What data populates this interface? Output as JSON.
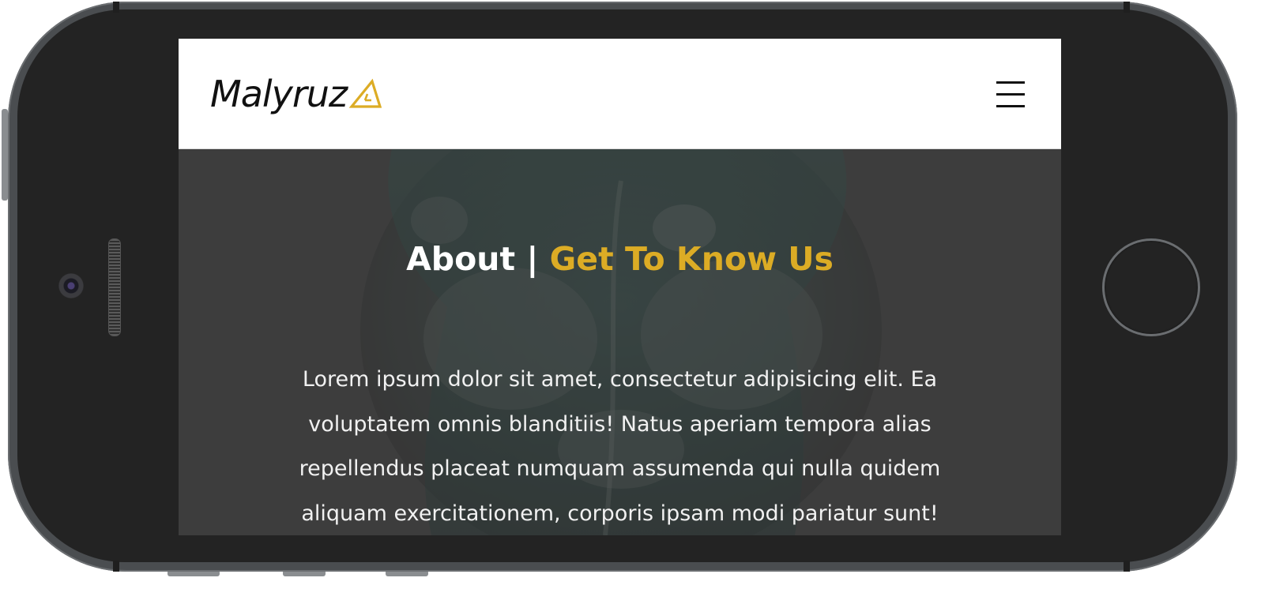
{
  "brand": {
    "name": "Malyruz",
    "accent_color": "#dcac25"
  },
  "nav": {
    "menu_icon": "hamburger-icon"
  },
  "hero": {
    "title_lead": "About |",
    "title_accent": "Get To Know Us",
    "body": "Lorem ipsum dolor sit amet, consectetur adipisicing elit. Ea voluptatem omnis blanditiis! Natus aperiam tempora alias repellendus placeat numquam assumenda qui nulla quidem aliquam exercitationem, corporis ipsam modi pariatur sunt!"
  },
  "colors": {
    "device_frame": "#232323",
    "navbar_bg": "#ffffff",
    "hero_overlay": "#2d2d2d"
  }
}
